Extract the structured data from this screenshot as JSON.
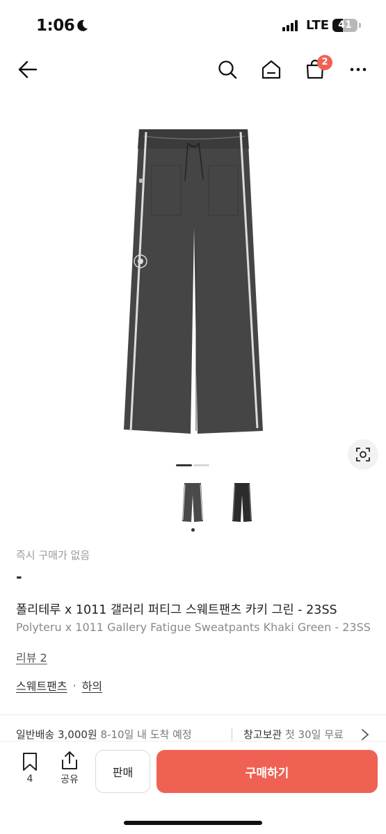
{
  "status_bar": {
    "time": "1:06",
    "network": "LTE",
    "battery": "41"
  },
  "nav": {
    "cart_badge": "2",
    "icons": [
      "back-arrow-icon",
      "search-icon",
      "home-icon",
      "shopping-bag-icon",
      "more-icon"
    ]
  },
  "product": {
    "instant_purchase": "즉시 구매가 없음",
    "price": "-",
    "title_ko": "폴리테루 x 1011 갤러리 퍼티그 스웨트팬츠 카키 그린 - 23SS",
    "title_en": "Polyteru x 1011 Gallery Fatigue Sweatpants Khaki Green - 23SS",
    "review": "리뷰 2",
    "categories": [
      "스웨트팬츠",
      "하의"
    ],
    "category_separator": "·"
  },
  "shipping": {
    "label": "일반배송",
    "fee": "3,000원",
    "eta": "8-10일 내 도착 예정",
    "storage_label": "창고보관",
    "storage_note": "첫 30일 무료"
  },
  "bottom_bar": {
    "bookmark_count": "4",
    "share_label": "공유",
    "sell_label": "판매",
    "buy_label": "구매하기"
  },
  "colors": {
    "accent": "#ef6253",
    "pants": "#454545"
  }
}
